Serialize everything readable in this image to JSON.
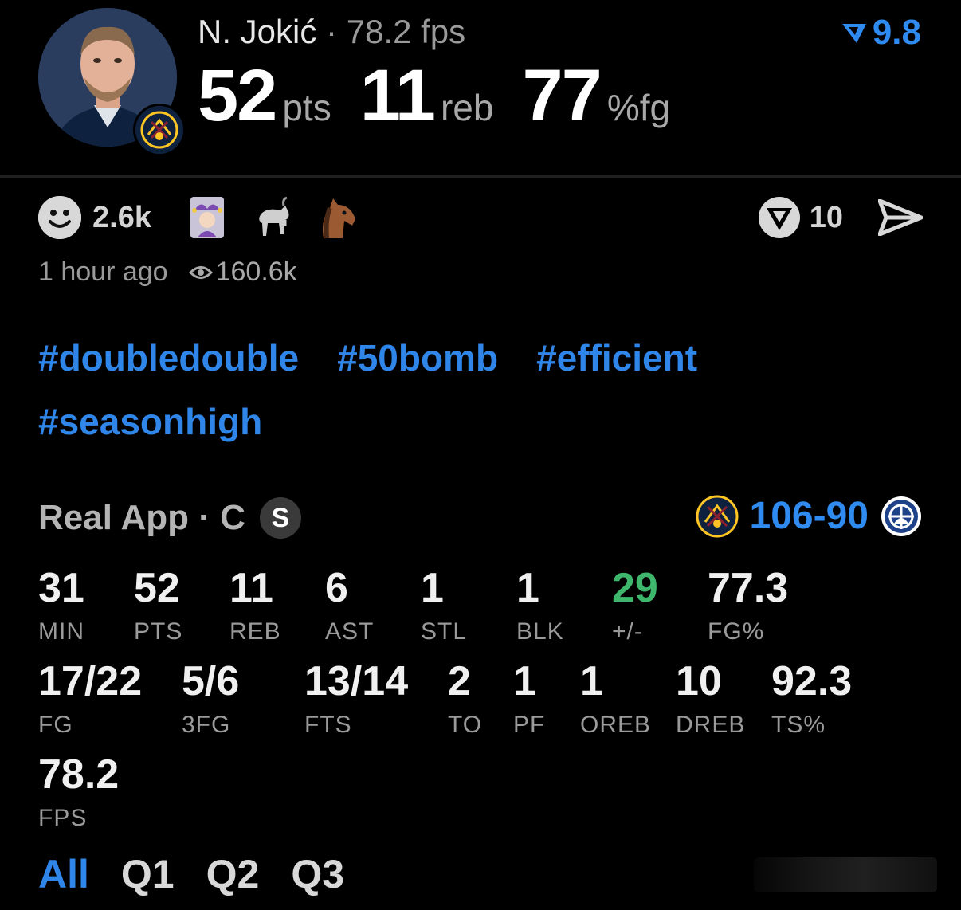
{
  "header": {
    "player_name": "N. Jokić",
    "separator": "·",
    "fps_text": "78.2 fps",
    "rating": "9.8",
    "big_stats": [
      {
        "value": "52",
        "unit": "pts"
      },
      {
        "value": "11",
        "unit": "reb"
      },
      {
        "value": "77",
        "unit": "%fg"
      }
    ]
  },
  "reactions": {
    "count": "2.6k",
    "emojis": [
      "jester-emoji",
      "goat-emoji",
      "horse-emoji"
    ],
    "vote_count": "10"
  },
  "meta": {
    "time_ago": "1 hour ago",
    "views": "160.6k"
  },
  "hashtags": [
    "#doubledouble",
    "#50bomb",
    "#efficient",
    "#seasonhigh"
  ],
  "source": {
    "label": "Real App · C",
    "badge": "S"
  },
  "game": {
    "score": "106-90"
  },
  "stats": [
    {
      "value": "31",
      "label": "MIN"
    },
    {
      "value": "52",
      "label": "PTS"
    },
    {
      "value": "11",
      "label": "REB"
    },
    {
      "value": "6",
      "label": "AST"
    },
    {
      "value": "1",
      "label": "STL"
    },
    {
      "value": "1",
      "label": "BLK"
    },
    {
      "value": "29",
      "label": "+/-"
    },
    {
      "value": "77.3",
      "label": "FG%"
    },
    {
      "value": "17/22",
      "label": "FG"
    },
    {
      "value": "5/6",
      "label": "3FG"
    },
    {
      "value": "13/14",
      "label": "FTS"
    },
    {
      "value": "2",
      "label": "TO"
    },
    {
      "value": "1",
      "label": "PF"
    },
    {
      "value": "1",
      "label": "OREB"
    },
    {
      "value": "10",
      "label": "DREB"
    },
    {
      "value": "92.3",
      "label": "TS%"
    },
    {
      "value": "78.2",
      "label": "FPS"
    }
  ],
  "period_tabs": [
    "All",
    "Q1",
    "Q2",
    "Q3"
  ],
  "active_tab": "All",
  "colors": {
    "accent": "#2f85e8",
    "positive": "#3eb66b",
    "background": "#000000"
  }
}
